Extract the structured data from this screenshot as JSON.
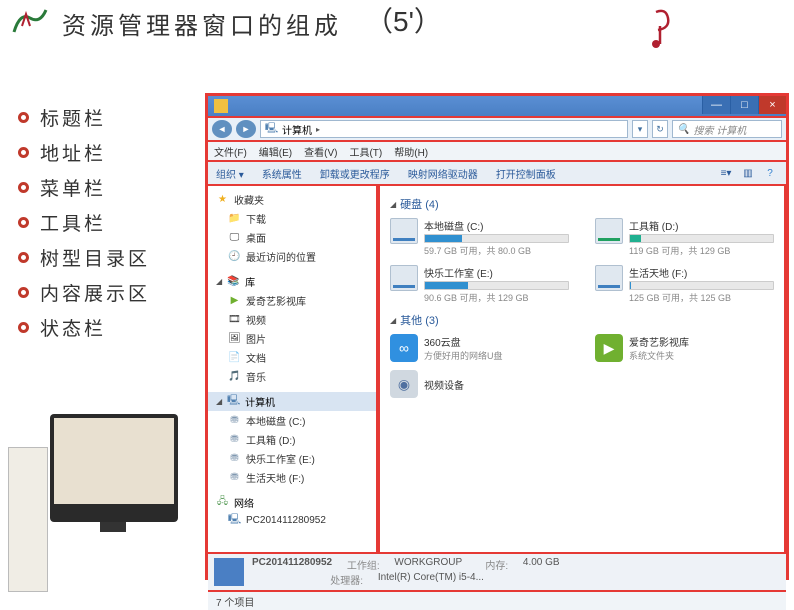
{
  "slide": {
    "title": "资源管理器窗口的组成",
    "score": "（5'）"
  },
  "outline": [
    "标题栏",
    "地址栏",
    "菜单栏",
    "工具栏",
    "树型目录区",
    "内容展示区",
    "状态栏"
  ],
  "window": {
    "win_min": "—",
    "win_max": "□",
    "win_close": "×"
  },
  "address": {
    "path_icon": "🖳",
    "path": "计算机",
    "pathsep": "▸",
    "search_placeholder": "搜索 计算机"
  },
  "menu": [
    "文件(F)",
    "编辑(E)",
    "查看(V)",
    "工具(T)",
    "帮助(H)"
  ],
  "toolbar": {
    "items": [
      "组织 ▾",
      "系统属性",
      "卸载或更改程序",
      "映射网络驱动器",
      "打开控制面板"
    ]
  },
  "tree": {
    "favorites": {
      "label": "收藏夹",
      "items": [
        "下载",
        "桌面",
        "最近访问的位置"
      ]
    },
    "libraries": {
      "label": "库",
      "items": [
        "爱奇艺影视库",
        "视频",
        "图片",
        "文档",
        "音乐"
      ]
    },
    "computer": {
      "label": "计算机",
      "items": [
        "本地磁盘 (C:)",
        "工具箱 (D:)",
        "快乐工作室 (E:)",
        "生活天地 (F:)"
      ]
    },
    "network": {
      "label": "网络",
      "items": [
        "PC201411280952"
      ]
    }
  },
  "content": {
    "group1": {
      "label": "硬盘 (4)"
    },
    "drives": [
      {
        "name": "本地磁盘 (C:)",
        "text": "59.7 GB 可用，共 80.0 GB",
        "fill": 26
      },
      {
        "name": "工具箱 (D:)",
        "text": "119 GB 可用，共 129 GB",
        "fill": 8,
        "teal": true
      },
      {
        "name": "快乐工作室 (E:)",
        "text": "90.6 GB 可用，共 129 GB",
        "fill": 30
      },
      {
        "name": "生活天地 (F:)",
        "text": "125 GB 可用，共 125 GB",
        "fill": 1
      }
    ],
    "group2": {
      "label": "其他 (3)"
    },
    "others": [
      {
        "name": "360云盘",
        "sub": "方便好用的网络U盘",
        "icon_class": "ic-blue",
        "glyph": "∞"
      },
      {
        "name": "爱奇艺影视库",
        "sub": "系统文件夹",
        "icon_class": "ic-green",
        "glyph": "▶"
      },
      {
        "name": "视频设备",
        "sub": "",
        "icon_class": "ic-cam",
        "glyph": "◉"
      }
    ]
  },
  "infobar": {
    "name": "PC201411280952",
    "wg_label": "工作组:",
    "wg": "WORKGROUP",
    "mem_label": "内存:",
    "mem": "4.00 GB",
    "cpu_label": "处理器:",
    "cpu": "Intel(R) Core(TM) i5-4..."
  },
  "statusbar": {
    "text": "7 个项目"
  }
}
